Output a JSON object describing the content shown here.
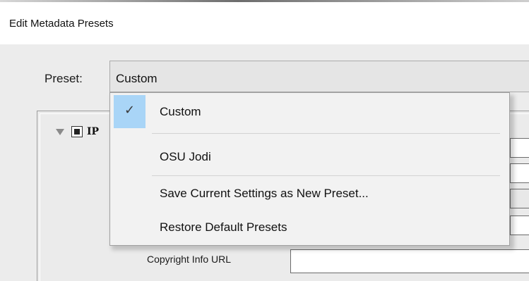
{
  "window": {
    "title": "Edit Metadata Presets"
  },
  "preset": {
    "label": "Preset:",
    "selected": "Custom"
  },
  "section": {
    "title": "IP"
  },
  "fields": {
    "copyright_info_url_label": "Copyright Info URL"
  },
  "dropdown": {
    "check_glyph": "✓",
    "items": [
      {
        "label": "Custom",
        "checked": true
      },
      {
        "label": "OSU Jodi",
        "checked": false
      },
      {
        "label": "Save Current Settings as New Preset...",
        "checked": false
      },
      {
        "label": "Restore Default Presets",
        "checked": false
      }
    ]
  },
  "colors": {
    "selection_highlight": "#a9d5f7"
  }
}
